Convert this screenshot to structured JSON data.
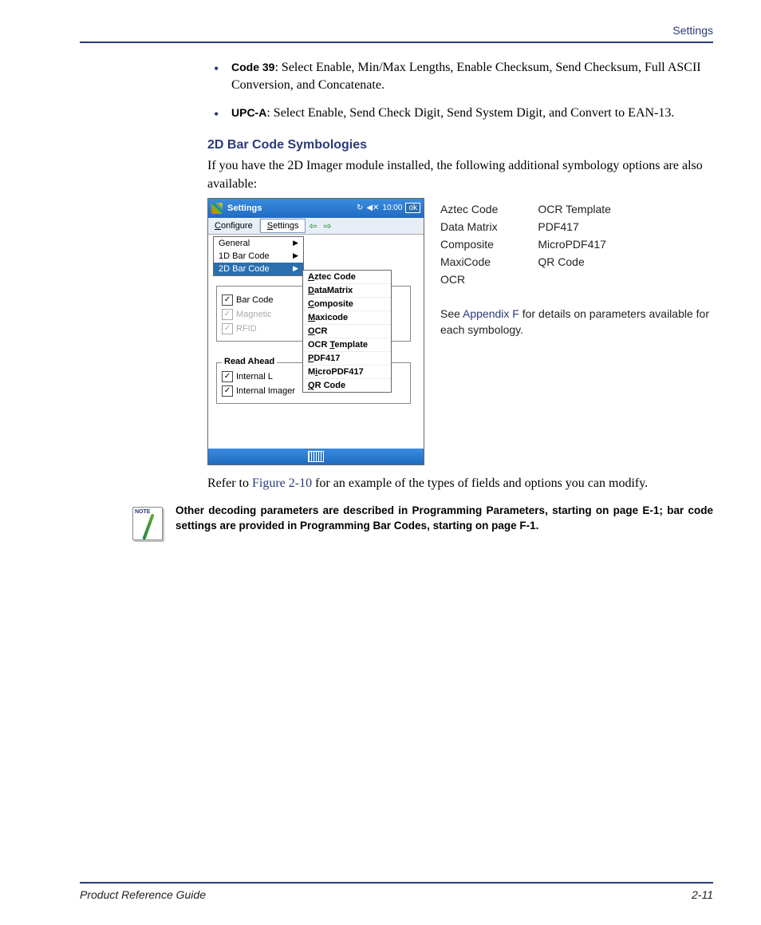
{
  "header": {
    "section": "Settings"
  },
  "bullets": [
    {
      "strong": "Code 39",
      "rest": ": Select Enable, Min/Max Lengths, Enable Checksum, Send Checksum, Full ASCII Conversion, and Concatenate."
    },
    {
      "strong": "UPC-A",
      "rest": ": Select Enable, Send Check Digit, Send System Digit, and Convert to EAN-13."
    }
  ],
  "section_heading": "2D Bar Code Symbologies",
  "intro_text": "If you have the 2D Imager module installed, the following additional symbology options are also available:",
  "mock": {
    "title": "Settings",
    "time": "10:00",
    "ok": "ok",
    "menubar": {
      "configure": "Configure",
      "settings": "Settings"
    },
    "dropdown1": [
      {
        "label": "General",
        "selected": false
      },
      {
        "label": "1D Bar Code",
        "selected": false
      },
      {
        "label": "2D Bar Code",
        "selected": true
      }
    ],
    "dropdown2": [
      "Aztec Code",
      "DataMatrix",
      "Composite",
      "Maxicode",
      "OCR",
      "OCR Template",
      "PDF417",
      "MicroPDF417",
      "QR Code"
    ],
    "group1": [
      {
        "label": "Bar Code",
        "checked": true,
        "disabled": false
      },
      {
        "label": "Magnetic",
        "checked": true,
        "disabled": true
      },
      {
        "label": "RFID",
        "checked": true,
        "disabled": true
      }
    ],
    "group2_title": "Read Ahead",
    "group2": [
      {
        "label": "Internal L",
        "checked": true
      },
      {
        "label": "Internal Imager",
        "checked": true
      }
    ]
  },
  "symbology_cols": {
    "left": [
      "Aztec Code",
      "Data Matrix",
      "Composite",
      "MaxiCode",
      "OCR"
    ],
    "right": [
      "OCR Template",
      "PDF417",
      "MicroPDF417",
      "QR Code"
    ]
  },
  "side_note": {
    "pre": "See ",
    "link": "Appendix F",
    "post": " for details on parameters available for each symbology."
  },
  "refer_text": {
    "pre": "Refer to ",
    "link": "Figure 2-10",
    "post": " for an example of the types of fields and options you can modify."
  },
  "note_text": "Other decoding parameters are described in Programming Parameters, starting on page E-1; bar code settings are provided in Programming Bar Codes, starting on page F-1.",
  "footer": {
    "left": "Product Reference Guide",
    "right": "2-11"
  }
}
